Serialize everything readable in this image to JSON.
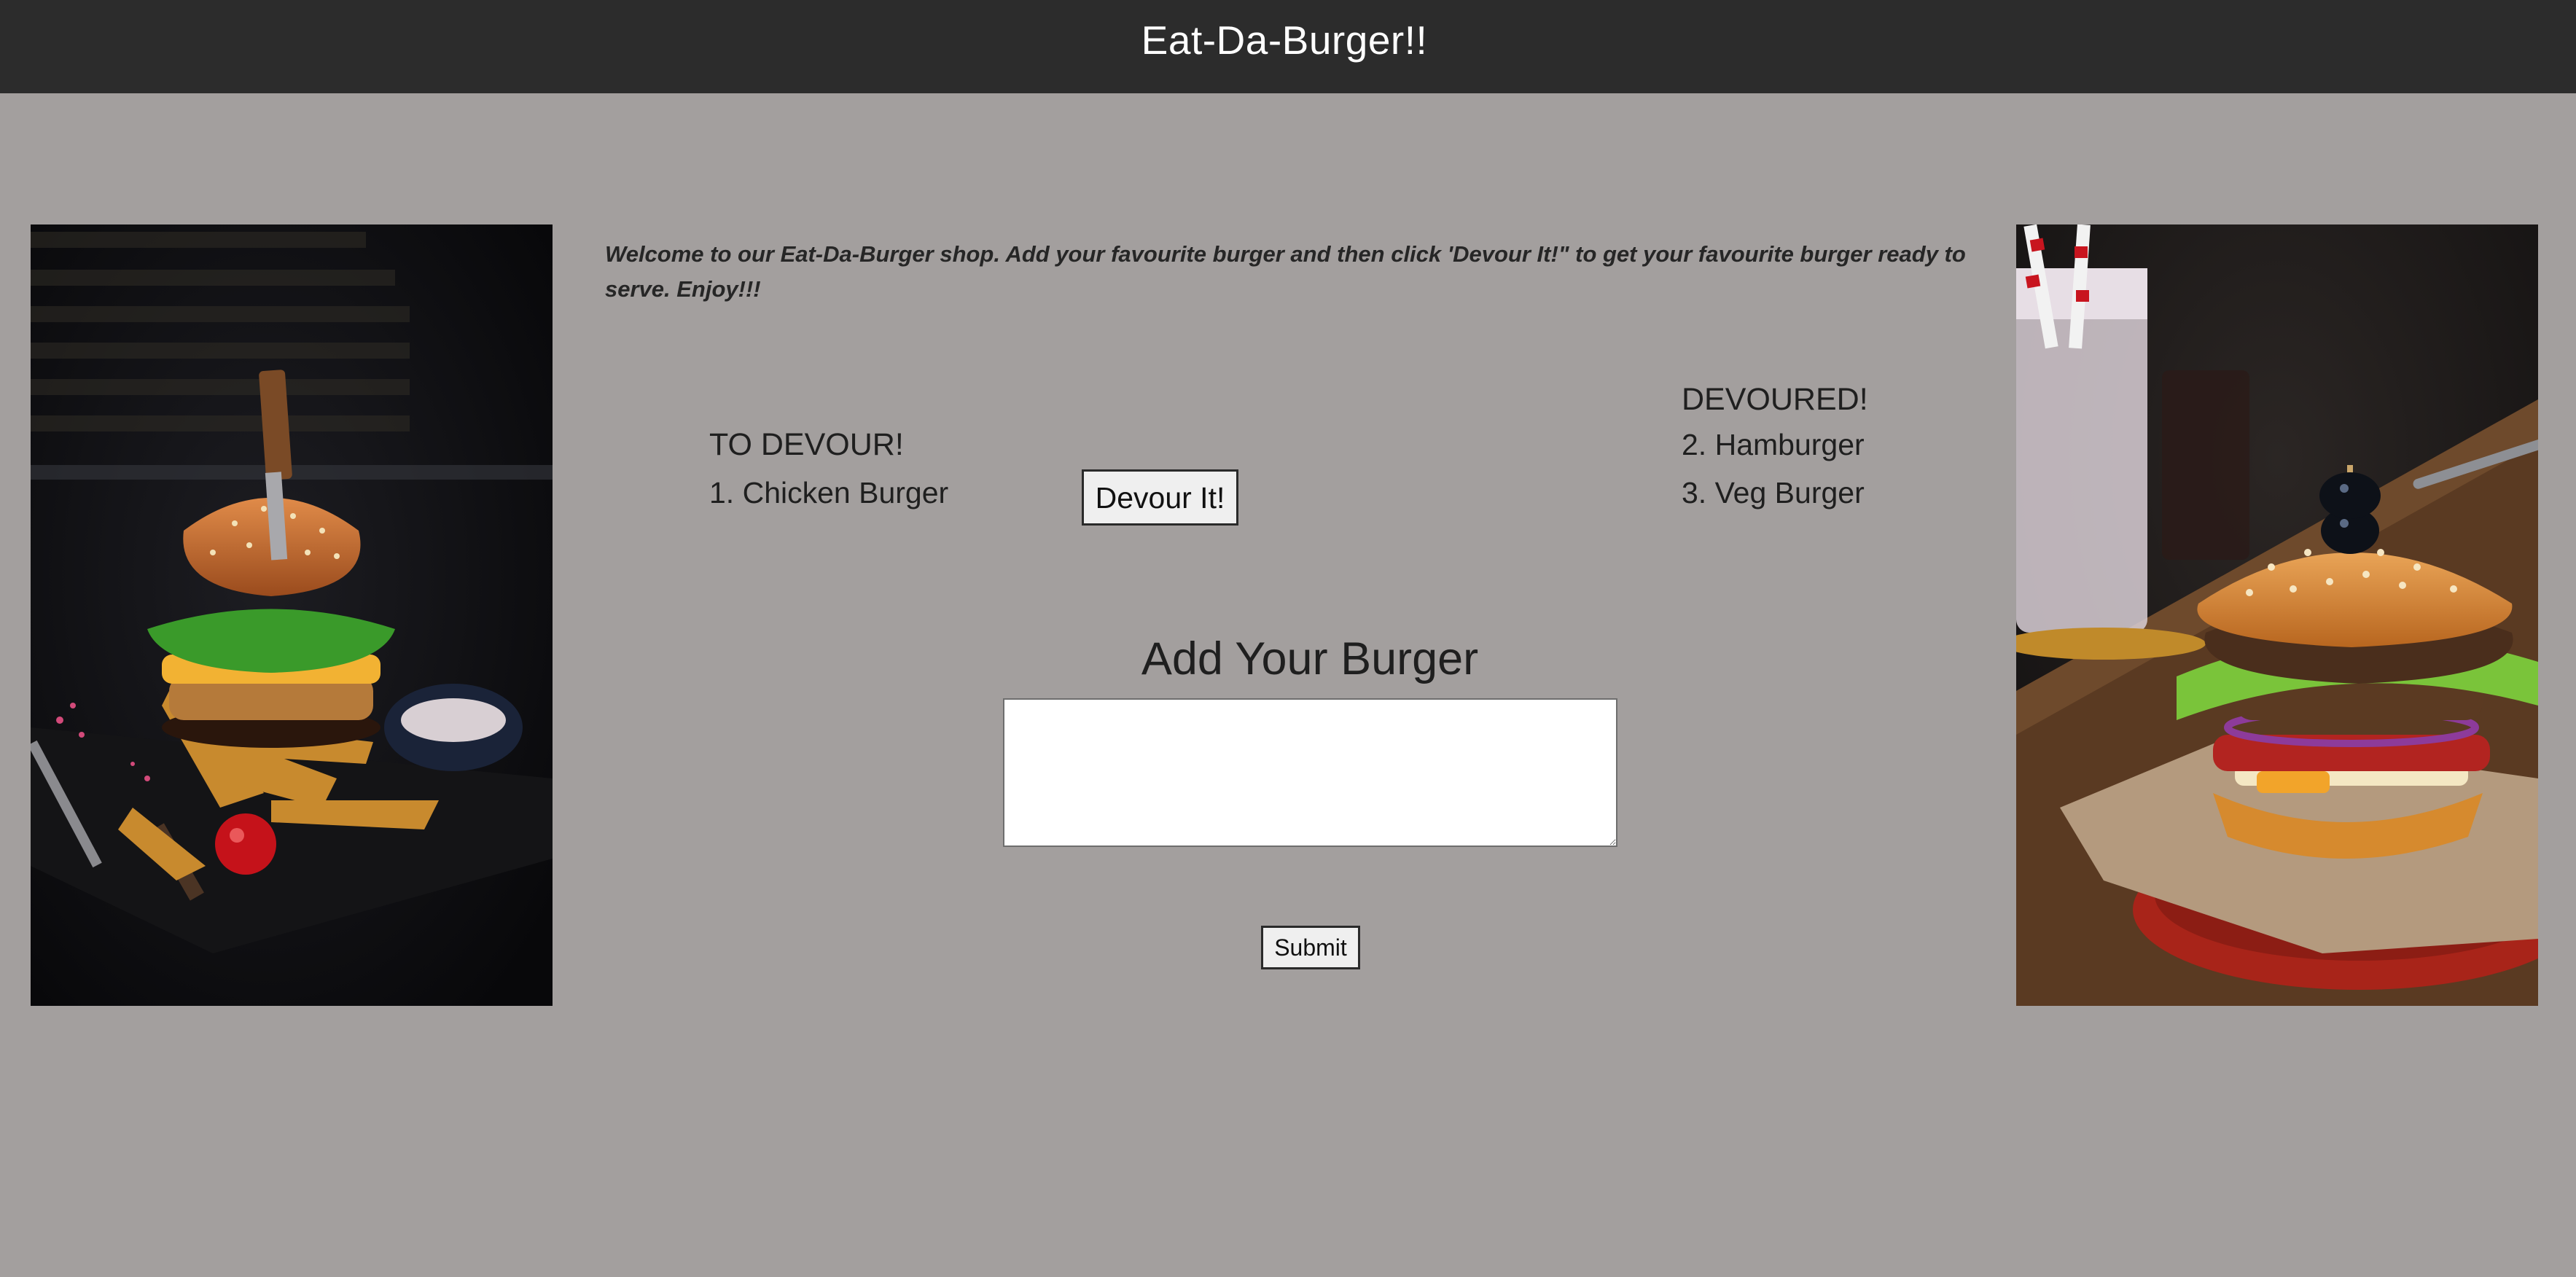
{
  "header": {
    "title": "Eat-Da-Burger!!"
  },
  "welcome_text": "Welcome to our Eat-Da-Burger shop. Add your favourite burger and then click 'Devour It!\" to get your favourite burger ready to serve. Enjoy!!!",
  "to_devour": {
    "heading": "TO DEVOUR!",
    "items": [
      {
        "label": "1. Chicken Burger",
        "button_label": "Devour It!"
      }
    ]
  },
  "devoured": {
    "heading": "DEVOURED!",
    "items": [
      {
        "label": "2. Hamburger"
      },
      {
        "label": "3. Veg Burger"
      }
    ]
  },
  "add_form": {
    "heading": "Add Your Burger",
    "input_value": "",
    "submit_label": "Submit"
  },
  "images": {
    "left": "burger-with-knife-and-potato-wedges-photo",
    "right": "burger-with-milkshake-photo"
  },
  "colors": {
    "background": "#a39f9e",
    "header_bar": "#2c2c2c",
    "header_text": "#ffffff"
  }
}
